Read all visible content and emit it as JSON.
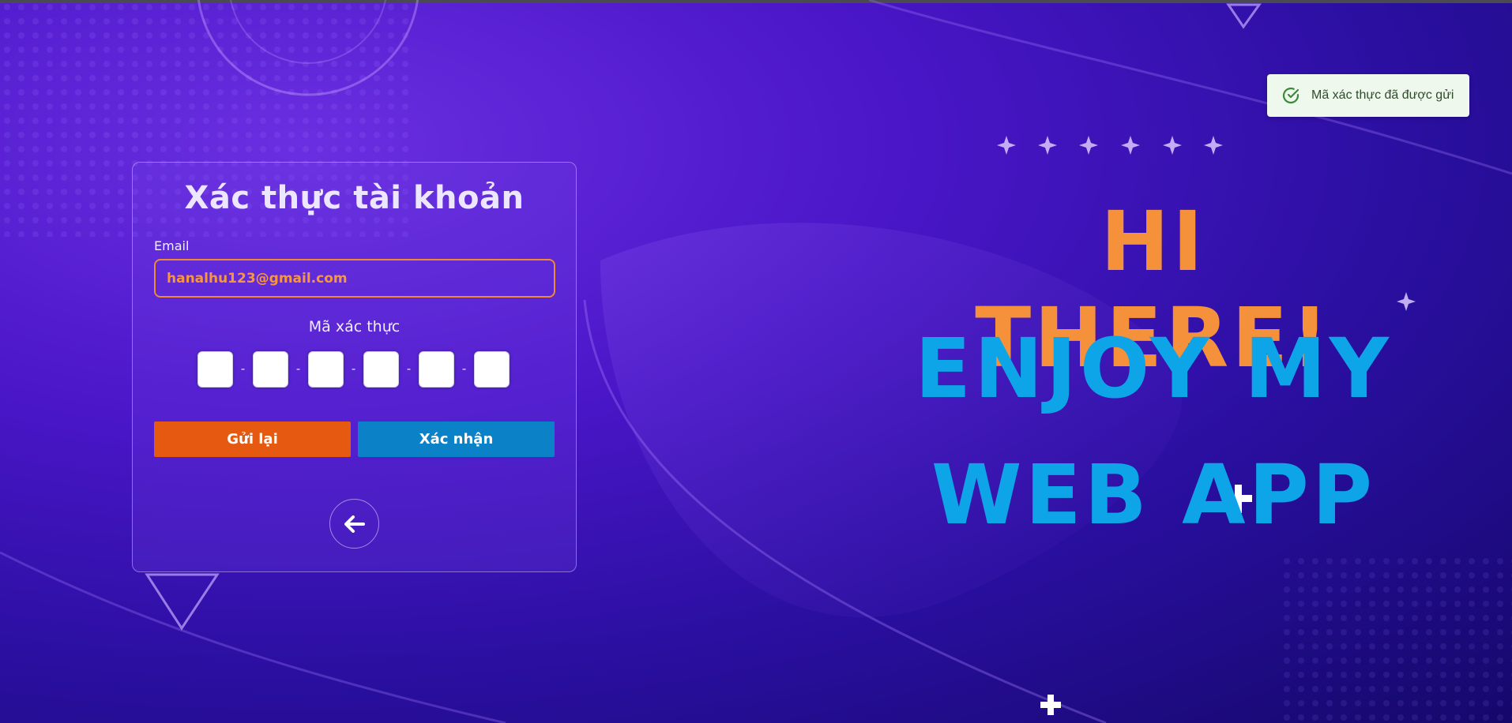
{
  "auth_form": {
    "title": "Xác thực tài khoản",
    "email_label": "Email",
    "email_value": "hanalhu123@gmail.com",
    "code_label": "Mã xác thực",
    "code_separator": "-",
    "code_boxes": [
      "",
      "",
      "",
      "",
      "",
      ""
    ],
    "resend_label": "Gửi lại",
    "confirm_label": "Xác nhận",
    "back_icon": "arrow-left-icon"
  },
  "toast": {
    "message": "Mã xác thực đã được gửi",
    "icon": "check-circle-icon"
  },
  "hero": {
    "line1": "HI THERE!",
    "line2": "ENJOY MY",
    "line3": "WEB APP"
  },
  "colors": {
    "accent_orange": "#f5913a",
    "accent_blue": "#0ea4e8",
    "resend_button": "#e55a10",
    "confirm_button": "#0b82c8",
    "email_border": "#f08a30",
    "toast_background": "#eef8ec"
  }
}
